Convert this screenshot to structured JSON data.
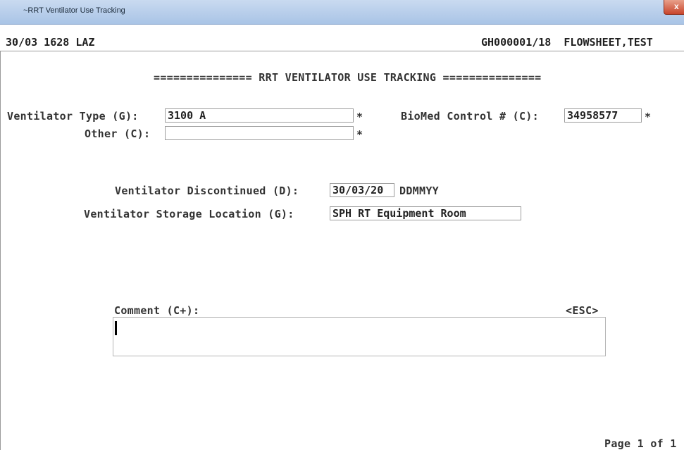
{
  "window": {
    "title": "~RRT Ventilator Use Tracking",
    "close_label": "x"
  },
  "status": {
    "left": "30/03 1628 LAZ",
    "right": "GH000001/18  FLOWSHEET,TEST"
  },
  "form": {
    "heading": "=============== RRT VENTILATOR USE TRACKING ===============",
    "ventilator_type": {
      "label": "Ventilator Type (G):",
      "value": "3100 A",
      "required": "*"
    },
    "other": {
      "label": "Other (C):",
      "value": "",
      "required": "*"
    },
    "biomed_control": {
      "label": "BioMed Control # (C):",
      "value": "34958577",
      "required": "*"
    },
    "discontinued": {
      "label": "Ventilator Discontinued (D):",
      "value": "30/03/20",
      "format": "DDMMYY"
    },
    "storage_location": {
      "label": "Ventilator Storage Location (G):",
      "value": "SPH RT Equipment Room"
    },
    "comment": {
      "label": "Comment (C+):",
      "esc": "<ESC>",
      "value": ""
    }
  },
  "footer": {
    "page_indicator": "Page 1 of 1"
  },
  "colors": {
    "titlebar": "#b8cfee",
    "close_button": "#c8452c"
  }
}
